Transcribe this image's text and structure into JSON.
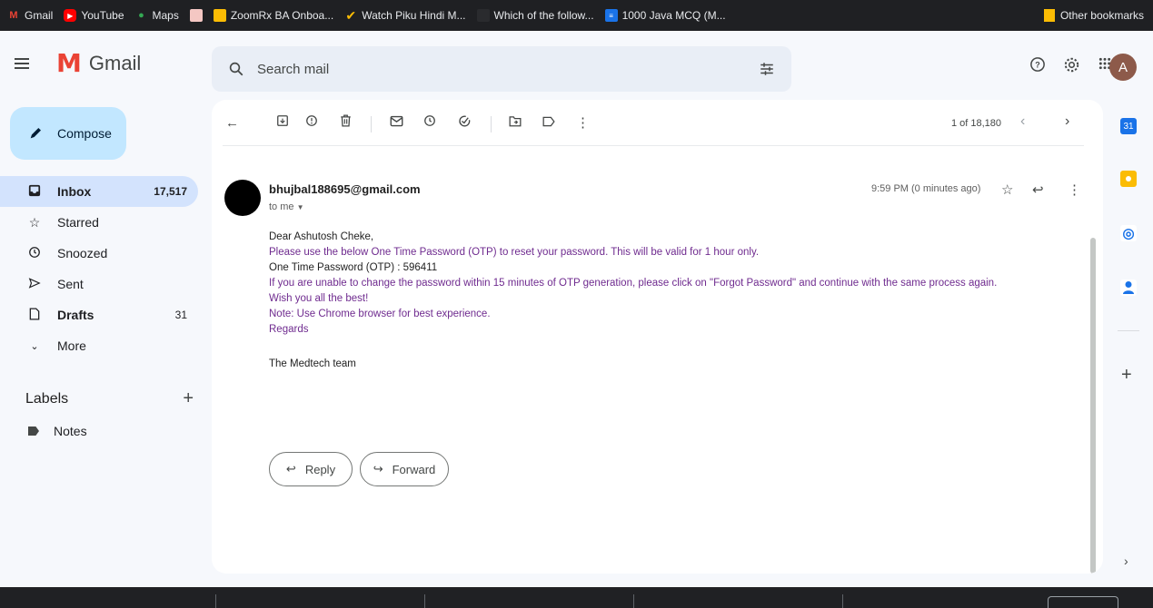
{
  "bookmarks": {
    "items": [
      {
        "label": "Gmail",
        "icon": "gmail-icon"
      },
      {
        "label": "YouTube",
        "icon": "youtube-icon"
      },
      {
        "label": "Maps",
        "icon": "maps-icon"
      },
      {
        "label": "",
        "icon": "image-icon"
      },
      {
        "label": "ZoomRx BA Onboa...",
        "icon": "slides-icon"
      },
      {
        "label": "Watch Piku Hindi M...",
        "icon": "checkmark-icon"
      },
      {
        "label": "Which of the follow...",
        "icon": "blank-icon"
      },
      {
        "label": "1000 Java MCQ (M...",
        "icon": "site-icon"
      }
    ],
    "other": "Other bookmarks"
  },
  "header": {
    "logo": "Gmail",
    "search_placeholder": "Search mail",
    "avatar_letter": "A"
  },
  "compose": {
    "label": "Compose"
  },
  "nav": {
    "inbox": {
      "label": "Inbox",
      "count": "17,517"
    },
    "starred": {
      "label": "Starred"
    },
    "snoozed": {
      "label": "Snoozed"
    },
    "sent": {
      "label": "Sent"
    },
    "drafts": {
      "label": "Drafts",
      "count": "31"
    },
    "more": {
      "label": "More"
    }
  },
  "labels": {
    "title": "Labels",
    "items": [
      {
        "label": "Notes"
      }
    ]
  },
  "toolbar": {
    "pager": "1 of 18,180"
  },
  "message": {
    "sender": "bhujbal188695@gmail.com",
    "to": "to me",
    "time": "9:59 PM (0 minutes ago)",
    "lines": [
      "Dear Ashutosh Cheke,",
      "Please use the below One Time Password (OTP) to reset your password. This will be valid for 1 hour only.",
      "One Time Password (OTP) : 596411",
      "If you are unable to change the password within 15 minutes of OTP generation, please click on \"Forgot Password\" and continue with the same process again.",
      "Wish you all the best!",
      "Note: Use Chrome browser for best experience.",
      "Regards",
      "The Medtech team"
    ]
  },
  "actions": {
    "reply": "Reply",
    "forward": "Forward"
  },
  "colors": {
    "accent": "#c2e7ff",
    "active_nav": "#d3e3fd",
    "body_text": "#6f2b8f",
    "avatar": "#8d5a4a"
  }
}
